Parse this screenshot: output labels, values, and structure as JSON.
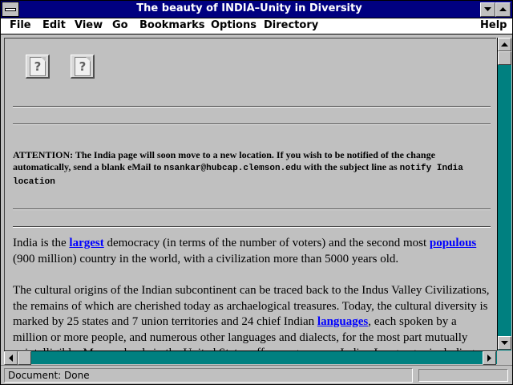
{
  "window": {
    "title": "The beauty of INDIA–Unity in Diversity"
  },
  "menu": {
    "file": "File",
    "edit": "Edit",
    "view": "View",
    "go": "Go",
    "bookmarks": "Bookmarks",
    "options": "Options",
    "directory": "Directory",
    "help": "Help"
  },
  "content": {
    "placeholder_icon_glyph": "?",
    "attention": {
      "text_1": "ATTENTION: The India page will soon move to a new location. If you wish to be notified of the change automatically, send a blank eMail to ",
      "email": "nsankar@hubcap.clemson.edu",
      "text_2": " with the subject line as ",
      "subject": "notify India location"
    },
    "para1": {
      "text_1": "India is the ",
      "link_1": "largest",
      "text_2": " democracy (in terms of the number of voters) and the second most ",
      "link_2": "populous",
      "text_3": " (900 million) country in the world, with a civilization more than 5000 years old."
    },
    "para2": {
      "text_1": "The cultural origins of the Indian subcontinent can be traced back to the Indus Valley Civilizations, the remains of which are cherished today as archaelogical treasures. Today, the cultural diversity is marked by 25 states and 7 union territories and 24 chief Indian ",
      "link_1": "languages",
      "text_2": ", each spoken by a million or more people, and numerous other languages and dialects, for the most part mutually unintelligible. Many schools in the United States offer programs on Indian Languages including, one"
    }
  },
  "status": {
    "text": "Document: Done"
  },
  "colors": {
    "title_bar": "#000080",
    "link": "#0000ff",
    "scrollbar_track": "#008080",
    "page_background": "#c0c0c0"
  },
  "icons": [
    "system-menu-icon",
    "minimize-arrow-icon",
    "maximize-arrow-icon",
    "broken-image-icon",
    "scroll-up-arrow-icon",
    "scroll-down-arrow-icon",
    "scroll-left-arrow-icon",
    "scroll-right-arrow-icon"
  ]
}
